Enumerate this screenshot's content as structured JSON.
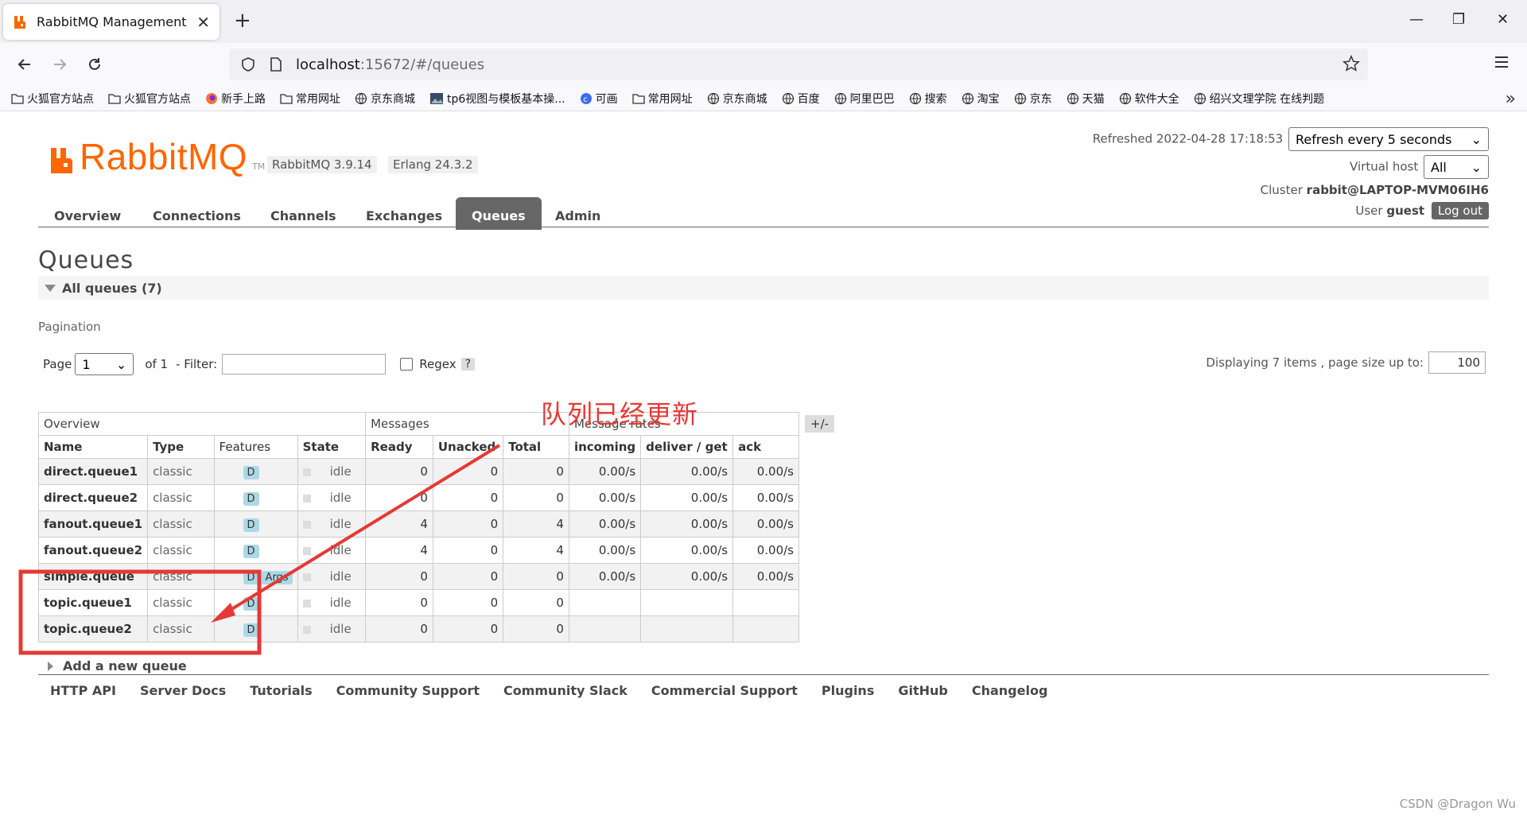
{
  "browser": {
    "tab_title": "RabbitMQ Management",
    "tab_close": "✕",
    "new_tab": "+",
    "url_host": "localhost",
    "url_rest": ":15672/#/queues",
    "bookmarks": [
      {
        "icon": "folder-icon",
        "label": "火狐官方站点"
      },
      {
        "icon": "folder-icon",
        "label": "火狐官方站点"
      },
      {
        "icon": "firefox-icon",
        "label": "新手上路"
      },
      {
        "icon": "folder-icon",
        "label": "常用网址"
      },
      {
        "icon": "globe-icon",
        "label": "京东商城"
      },
      {
        "icon": "image-icon",
        "label": "tp6视图与模板基本操..."
      },
      {
        "icon": "c-logo-icon",
        "label": "可画"
      },
      {
        "icon": "folder-icon",
        "label": "常用网址"
      },
      {
        "icon": "globe-icon",
        "label": "京东商城"
      },
      {
        "icon": "globe-icon",
        "label": "百度"
      },
      {
        "icon": "globe-icon",
        "label": "阿里巴巴"
      },
      {
        "icon": "globe-icon",
        "label": "搜索"
      },
      {
        "icon": "globe-icon",
        "label": "淘宝"
      },
      {
        "icon": "globe-icon",
        "label": "京东"
      },
      {
        "icon": "globe-icon",
        "label": "天猫"
      },
      {
        "icon": "globe-icon",
        "label": "软件大全"
      },
      {
        "icon": "globe-icon",
        "label": "绍兴文理学院 在线判题"
      }
    ],
    "bookmarks_more": "»"
  },
  "header": {
    "logo_text": "RabbitMQ",
    "logo_tm": "TM",
    "rabbitmq_version": "RabbitMQ 3.9.14",
    "erlang_version": "Erlang 24.3.2",
    "refreshed_label": "Refreshed",
    "refreshed_time": "2022-04-28 17:18:53",
    "refresh_select": "Refresh every 5 seconds",
    "vhost_label": "Virtual host",
    "vhost_select": "All",
    "cluster_label": "Cluster",
    "cluster_name": "rabbit@LAPTOP-MVM06IH6",
    "user_label": "User",
    "user_name": "guest",
    "logout": "Log out"
  },
  "nav": {
    "tabs": [
      "Overview",
      "Connections",
      "Channels",
      "Exchanges",
      "Queues",
      "Admin"
    ],
    "active": "Queues"
  },
  "page": {
    "title": "Queues",
    "section": "All queues (7)",
    "pagination_label": "Pagination",
    "page_label": "Page",
    "page_value": "1",
    "of_label": "of 1",
    "filter_label": "- Filter:",
    "regex_label": "Regex",
    "help": "?",
    "displaying": "Displaying 7 items , page size up to:",
    "page_size": "100",
    "plusminus": "+/-",
    "add_queue": "Add a new queue"
  },
  "table": {
    "groups": [
      "Overview",
      "Messages",
      "Message rates"
    ],
    "headers": [
      "Name",
      "Type",
      "Features",
      "State",
      "Ready",
      "Unacked",
      "Total",
      "incoming",
      "deliver / get",
      "ack"
    ],
    "rows": [
      {
        "name": "direct.queue1",
        "type": "classic",
        "features": "D",
        "state": "idle",
        "ready": "0",
        "unacked": "0",
        "total": "0",
        "incoming": "0.00/s",
        "deliver": "0.00/s",
        "ack": "0.00/s"
      },
      {
        "name": "direct.queue2",
        "type": "classic",
        "features": "D",
        "state": "idle",
        "ready": "0",
        "unacked": "0",
        "total": "0",
        "incoming": "0.00/s",
        "deliver": "0.00/s",
        "ack": "0.00/s"
      },
      {
        "name": "fanout.queue1",
        "type": "classic",
        "features": "D",
        "state": "idle",
        "ready": "4",
        "unacked": "0",
        "total": "4",
        "incoming": "0.00/s",
        "deliver": "0.00/s",
        "ack": "0.00/s"
      },
      {
        "name": "fanout.queue2",
        "type": "classic",
        "features": "D",
        "state": "idle",
        "ready": "4",
        "unacked": "0",
        "total": "4",
        "incoming": "0.00/s",
        "deliver": "0.00/s",
        "ack": "0.00/s"
      },
      {
        "name": "simple.queue",
        "type": "classic",
        "features": "D Args",
        "state": "idle",
        "ready": "0",
        "unacked": "0",
        "total": "0",
        "incoming": "0.00/s",
        "deliver": "0.00/s",
        "ack": "0.00/s"
      },
      {
        "name": "topic.queue1",
        "type": "classic",
        "features": "D",
        "state": "idle",
        "ready": "0",
        "unacked": "0",
        "total": "0",
        "incoming": "",
        "deliver": "",
        "ack": ""
      },
      {
        "name": "topic.queue2",
        "type": "classic",
        "features": "D",
        "state": "idle",
        "ready": "0",
        "unacked": "0",
        "total": "0",
        "incoming": "",
        "deliver": "",
        "ack": ""
      }
    ]
  },
  "footer": [
    "HTTP API",
    "Server Docs",
    "Tutorials",
    "Community Support",
    "Community Slack",
    "Commercial Support",
    "Plugins",
    "GitHub",
    "Changelog"
  ],
  "annotation": {
    "text": "队列已经更新",
    "color": "#e53935"
  },
  "watermark": "CSDN @Dragon  Wu",
  "colors": {
    "brand": "#ff6600",
    "tab_active": "#666666",
    "badge": "#add8e6"
  }
}
